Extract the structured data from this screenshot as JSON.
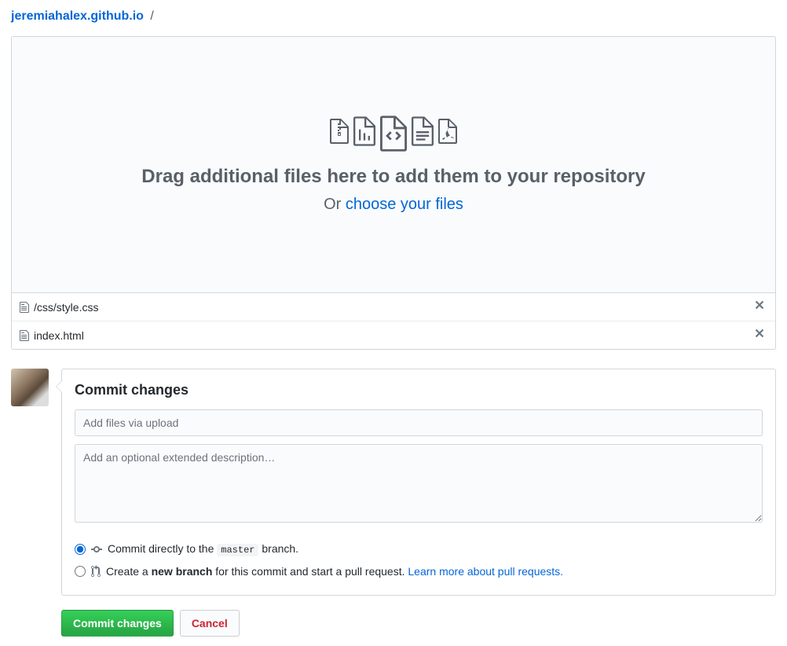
{
  "breadcrumb": {
    "repo": "jeremiahalex.github.io",
    "sep": "/"
  },
  "dropzone": {
    "title": "Drag additional files here to add them to your repository",
    "or_prefix": "Or ",
    "choose_link": "choose your files"
  },
  "files": [
    {
      "name": "/css/style.css"
    },
    {
      "name": "index.html"
    }
  ],
  "commit": {
    "heading": "Commit changes",
    "summary_placeholder": "Add files via upload",
    "description_placeholder": "Add an optional extended description…",
    "option_direct_prefix": "Commit directly to the ",
    "option_direct_branch": "master",
    "option_direct_suffix": " branch.",
    "option_newbranch_prefix": "Create a ",
    "option_newbranch_bold": "new branch",
    "option_newbranch_mid": " for this commit and start a pull request. ",
    "option_newbranch_link": "Learn more about pull requests."
  },
  "buttons": {
    "commit": "Commit changes",
    "cancel": "Cancel"
  }
}
